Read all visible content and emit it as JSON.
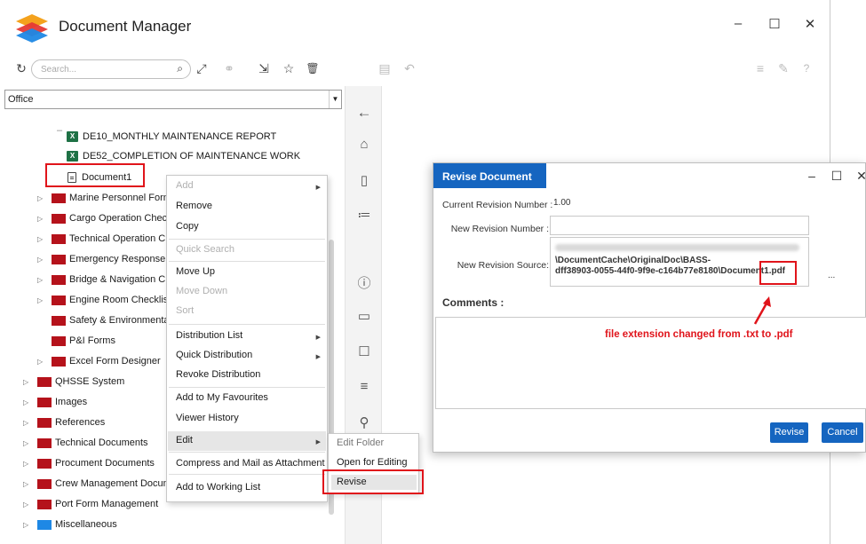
{
  "app": {
    "title": "Document Manager",
    "window_controls": {
      "minimize": "–",
      "maximize": "☐",
      "close": "✕"
    }
  },
  "toolbar": {
    "search_placeholder": "Search...",
    "icons": [
      "refresh-icon",
      "search-icon",
      "expand-icon",
      "link-icon",
      "send-icon",
      "star-icon",
      "delete-icon",
      "save-icon",
      "undo-icon",
      "list-icon",
      "tools-icon",
      "help-icon"
    ],
    "glyphs": {
      "refresh": "↻",
      "search": "⌕",
      "expand": "⤢",
      "link": "⚭",
      "send": "⇲",
      "star": "☆",
      "delete": "🗑",
      "save": "▤",
      "undo": "↶",
      "list": "≡",
      "tools": "✎",
      "help": "?"
    }
  },
  "location_dropdown": {
    "value": "Office"
  },
  "tree": {
    "items": [
      {
        "label": "DE10_MONTHLY MAINTENANCE REPORT",
        "kind": "excel"
      },
      {
        "label": "DE52_COMPLETION OF MAINTENANCE WORK",
        "kind": "excel"
      },
      {
        "label": "Document1",
        "kind": "document"
      },
      {
        "label": "Marine Personnel Form",
        "kind": "folder"
      },
      {
        "label": "Cargo Operation Check",
        "kind": "folder"
      },
      {
        "label": "Technical Operation Ch",
        "kind": "folder"
      },
      {
        "label": "Emergency Response C",
        "kind": "folder"
      },
      {
        "label": "Bridge & Navigation Che",
        "kind": "folder"
      },
      {
        "label": "Engine Room Checklist",
        "kind": "folder"
      },
      {
        "label": "Safety & Environmental",
        "kind": "folder"
      },
      {
        "label": "P&I Forms",
        "kind": "folder"
      },
      {
        "label": "Excel Form Designer",
        "kind": "folder"
      },
      {
        "label": "QHSSE System",
        "kind": "folder"
      },
      {
        "label": "Images",
        "kind": "folder"
      },
      {
        "label": "References",
        "kind": "folder"
      },
      {
        "label": "Technical Documents",
        "kind": "folder"
      },
      {
        "label": "Procument Documents",
        "kind": "folder"
      },
      {
        "label": "Crew Management Docume",
        "kind": "folder"
      },
      {
        "label": "Port Form Management",
        "kind": "folder"
      },
      {
        "label": "Miscellaneous",
        "kind": "folder"
      }
    ],
    "expander": "▷"
  },
  "side_icons": [
    "back-arrow-icon",
    "home-icon",
    "page-icon",
    "checklist-icon",
    "info-icon",
    "archive-icon",
    "comment-icon",
    "list-icon",
    "search-icon"
  ],
  "side_glyphs": {
    "back": "←",
    "home": "⌂",
    "page": "▯",
    "checklist": "≔",
    "info": "ⓘ",
    "archive": "▭",
    "comment": "☐",
    "list": "≡",
    "search": "⚲"
  },
  "context_menu": {
    "add": "Add",
    "remove": "Remove",
    "copy": "Copy",
    "quick_search": "Quick Search",
    "move_up": "Move Up",
    "move_down": "Move Down",
    "sort": "Sort",
    "distribution_list": "Distribution List",
    "quick_distribution": "Quick Distribution",
    "revoke_distribution": "Revoke Distribution",
    "add_favourites": "Add to My Favourites",
    "viewer_history": "Viewer History",
    "edit": "Edit",
    "compress_mail": "Compress and Mail as Attachment",
    "add_working_list": "Add to Working List",
    "submenu_arrow": "▶"
  },
  "edit_submenu": {
    "edit_folder": "Edit Folder",
    "open_editing": "Open for Editing",
    "revise": "Revise"
  },
  "dialog": {
    "title": "Revise Document",
    "current_revision_label": "Current Revision Number :",
    "current_revision_value": "1.00",
    "new_revision_label": "New Revision Number :",
    "new_revision_value": "",
    "source_label": "New Revision Source:",
    "source_line1": "\\DocumentCache\\OriginalDoc\\BASS-",
    "source_line2": "dff38903-0055-44f0-9f9e-c164b77e8180\\Document1.pdf",
    "browse": "...",
    "comments_label": "Comments :",
    "revise_button": "Revise",
    "cancel_button": "Cancel"
  },
  "annotation": {
    "text": "file extension changed from .txt to .pdf",
    "color": "#e0141b"
  },
  "colors": {
    "accent": "#1565c0",
    "folder_red": "#b5121b",
    "folder_blue": "#1e88e5",
    "highlight_red": "#e0141b"
  }
}
